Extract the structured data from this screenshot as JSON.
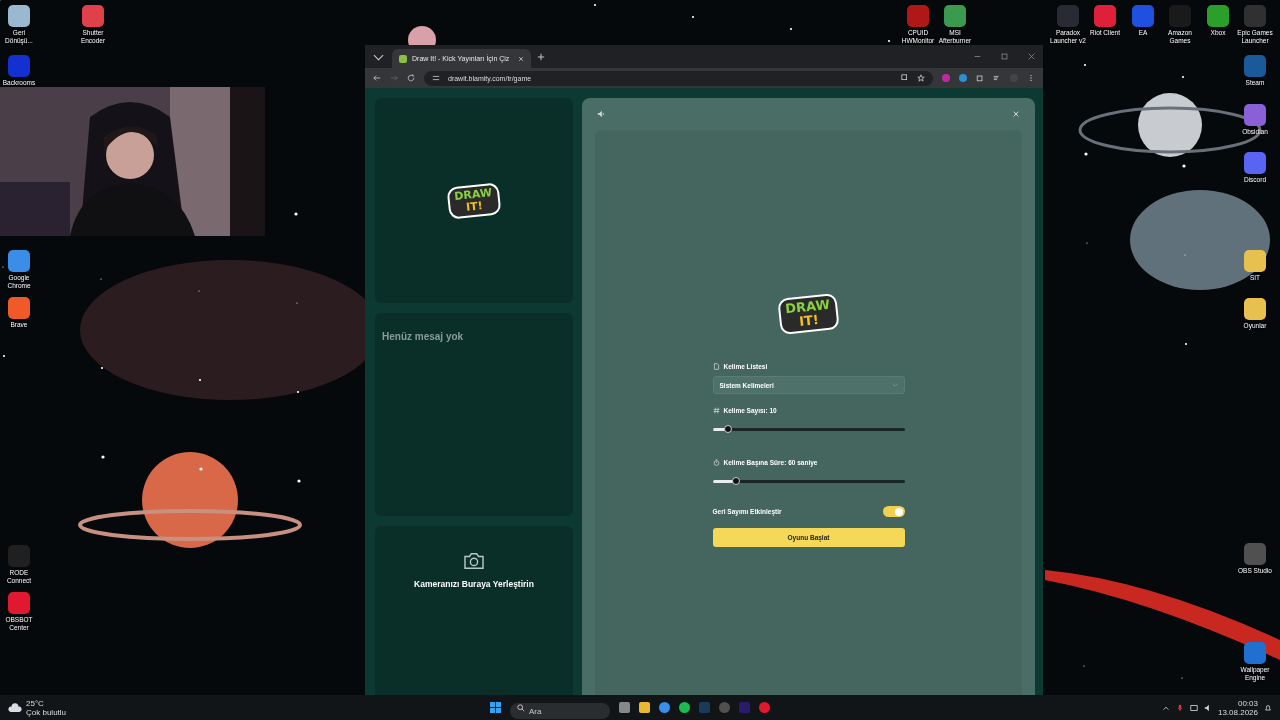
{
  "desktop": {
    "icons": [
      {
        "label": "Geri Dönüşü..."
      },
      {
        "label": "Shutter Encoder"
      },
      {
        "label": "Backrooms"
      },
      {
        "label": "Google Chrome"
      },
      {
        "label": "Brave"
      },
      {
        "label": "RODE Connect"
      },
      {
        "label": "OBSBOT Center"
      },
      {
        "label": "CPUID HWMonitor"
      },
      {
        "label": "MSI Afterburner"
      },
      {
        "label": "Paradox Launcher v2"
      },
      {
        "label": "Riot Client"
      },
      {
        "label": "EA"
      },
      {
        "label": "Amazon Games"
      },
      {
        "label": "Xbox"
      },
      {
        "label": "Epic Games Launcher"
      },
      {
        "label": "Steam"
      },
      {
        "label": "Obsidian"
      },
      {
        "label": "Discord"
      },
      {
        "label": "SIT"
      },
      {
        "label": "Oyunlar"
      },
      {
        "label": "OBS Studio"
      },
      {
        "label": "Wallpaper Engine"
      }
    ]
  },
  "browser": {
    "tab": {
      "title": "Draw It! - Kick Yayınları İçin Çiz",
      "selected": true
    },
    "url": "drawit.blamity.com/tr/game"
  },
  "page": {
    "logo": {
      "line1": "DRAW",
      "line2": "IT!"
    },
    "setup_logo": {
      "line1": "DRAW",
      "line2": "IT!"
    },
    "chat": {
      "empty_text": "Henüz mesaj yok"
    },
    "camera": {
      "text": "Kameranızı Buraya Yerleştirin"
    },
    "settings": {
      "word_list": {
        "label": "Kelime Listesi",
        "value": "Sistem Kelimeleri"
      },
      "sliders": [
        {
          "label": "Kelime Sayısı: 10",
          "level": 0.08
        },
        {
          "label": "Kelime Başına Süre: 60 saniye",
          "level": 0.12
        }
      ],
      "countdown": {
        "label": "Geri Sayımı Etkinleştir",
        "on": true
      },
      "start_button": "Oyunu Başlat"
    }
  },
  "taskbar": {
    "weather": {
      "temp": "25°C",
      "condition": "Çok bulutlu"
    },
    "search": {
      "placeholder": "Ara"
    },
    "time": "00:03",
    "date": "13.08.2026"
  }
}
